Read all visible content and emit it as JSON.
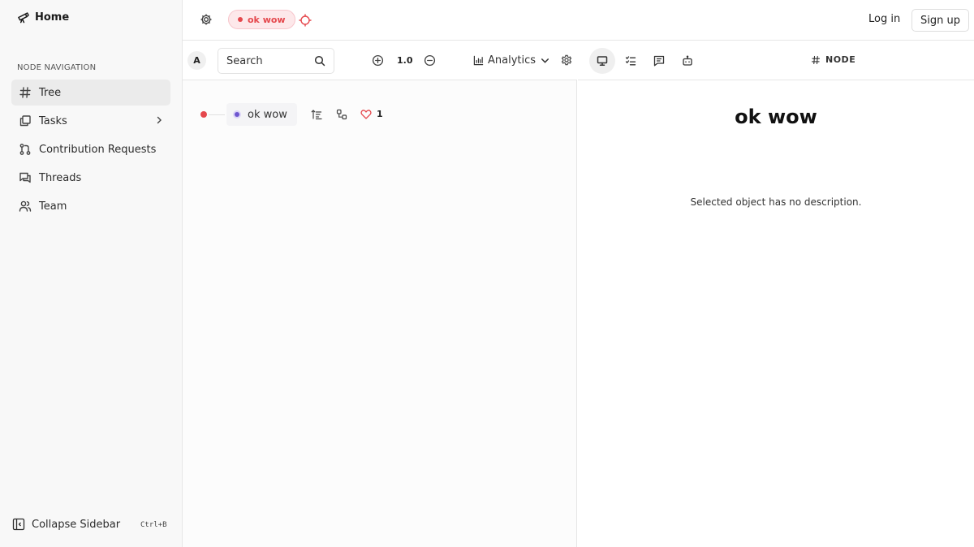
{
  "sidebar": {
    "brand": "Home",
    "nav_heading": "NODE NAVIGATION",
    "items": [
      {
        "label": "Tree",
        "icon": "hash-icon",
        "active": true
      },
      {
        "label": "Tasks",
        "icon": "tasks-icon",
        "has_submenu": true
      },
      {
        "label": "Contribution Requests",
        "icon": "pull-request-icon"
      },
      {
        "label": "Threads",
        "icon": "threads-icon"
      },
      {
        "label": "Team",
        "icon": "team-icon"
      }
    ],
    "collapse_label": "Collapse Sidebar",
    "collapse_shortcut": "Ctrl+B"
  },
  "header": {
    "node_pill": "ok wow",
    "login": "Log in",
    "signup": "Sign up"
  },
  "workspace": {
    "avatar": "A",
    "search_label": "Search",
    "zoom": "1.0",
    "analytics": "Analytics",
    "tree_node": {
      "title": "ok wow",
      "likes": "1"
    }
  },
  "detail": {
    "tag": "NODE",
    "title": "ok wow",
    "description": "Selected object has no description."
  },
  "colors": {
    "accent_red": "#e5484d",
    "accent_purple": "#6e56cf"
  }
}
